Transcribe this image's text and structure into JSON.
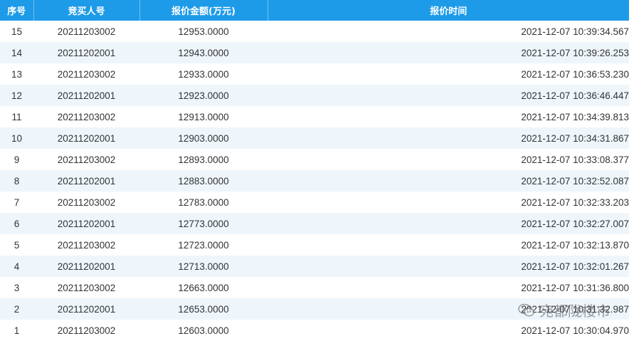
{
  "table": {
    "headers": {
      "seq": "序号",
      "bidder": "竞买人号",
      "amount": "报价金额(万元)",
      "time": "报价时间"
    },
    "rows": [
      {
        "seq": "15",
        "bidder": "20211203002",
        "amount": "12953.0000",
        "time": "2021-12-07 10:39:34.567"
      },
      {
        "seq": "14",
        "bidder": "20211202001",
        "amount": "12943.0000",
        "time": "2021-12-07 10:39:26.253"
      },
      {
        "seq": "13",
        "bidder": "20211203002",
        "amount": "12933.0000",
        "time": "2021-12-07 10:36:53.230"
      },
      {
        "seq": "12",
        "bidder": "20211202001",
        "amount": "12923.0000",
        "time": "2021-12-07 10:36:46.447"
      },
      {
        "seq": "11",
        "bidder": "20211203002",
        "amount": "12913.0000",
        "time": "2021-12-07 10:34:39.813"
      },
      {
        "seq": "10",
        "bidder": "20211202001",
        "amount": "12903.0000",
        "time": "2021-12-07 10:34:31.867"
      },
      {
        "seq": "9",
        "bidder": "20211203002",
        "amount": "12893.0000",
        "time": "2021-12-07 10:33:08.377"
      },
      {
        "seq": "8",
        "bidder": "20211202001",
        "amount": "12883.0000",
        "time": "2021-12-07 10:32:52.087"
      },
      {
        "seq": "7",
        "bidder": "20211203002",
        "amount": "12783.0000",
        "time": "2021-12-07 10:32:33.203"
      },
      {
        "seq": "6",
        "bidder": "20211202001",
        "amount": "12773.0000",
        "time": "2021-12-07 10:32:27.007"
      },
      {
        "seq": "5",
        "bidder": "20211203002",
        "amount": "12723.0000",
        "time": "2021-12-07 10:32:13.870"
      },
      {
        "seq": "4",
        "bidder": "20211202001",
        "amount": "12713.0000",
        "time": "2021-12-07 10:32:01.267"
      },
      {
        "seq": "3",
        "bidder": "20211203002",
        "amount": "12663.0000",
        "time": "2021-12-07 10:31:36.800"
      },
      {
        "seq": "2",
        "bidder": "20211202001",
        "amount": "12653.0000",
        "time": "2021-12-07 10:31:32.987"
      },
      {
        "seq": "1",
        "bidder": "20211203002",
        "amount": "12603.0000",
        "time": "2021-12-07 10:30:04.970"
      }
    ]
  },
  "watermark": {
    "text": "宛都陇楼市",
    "icon": "wechat-logo-icon"
  },
  "colors": {
    "header_bg": "#1e9be8",
    "header_text": "#ffffff",
    "row_alt_bg": "#eef6fc"
  }
}
